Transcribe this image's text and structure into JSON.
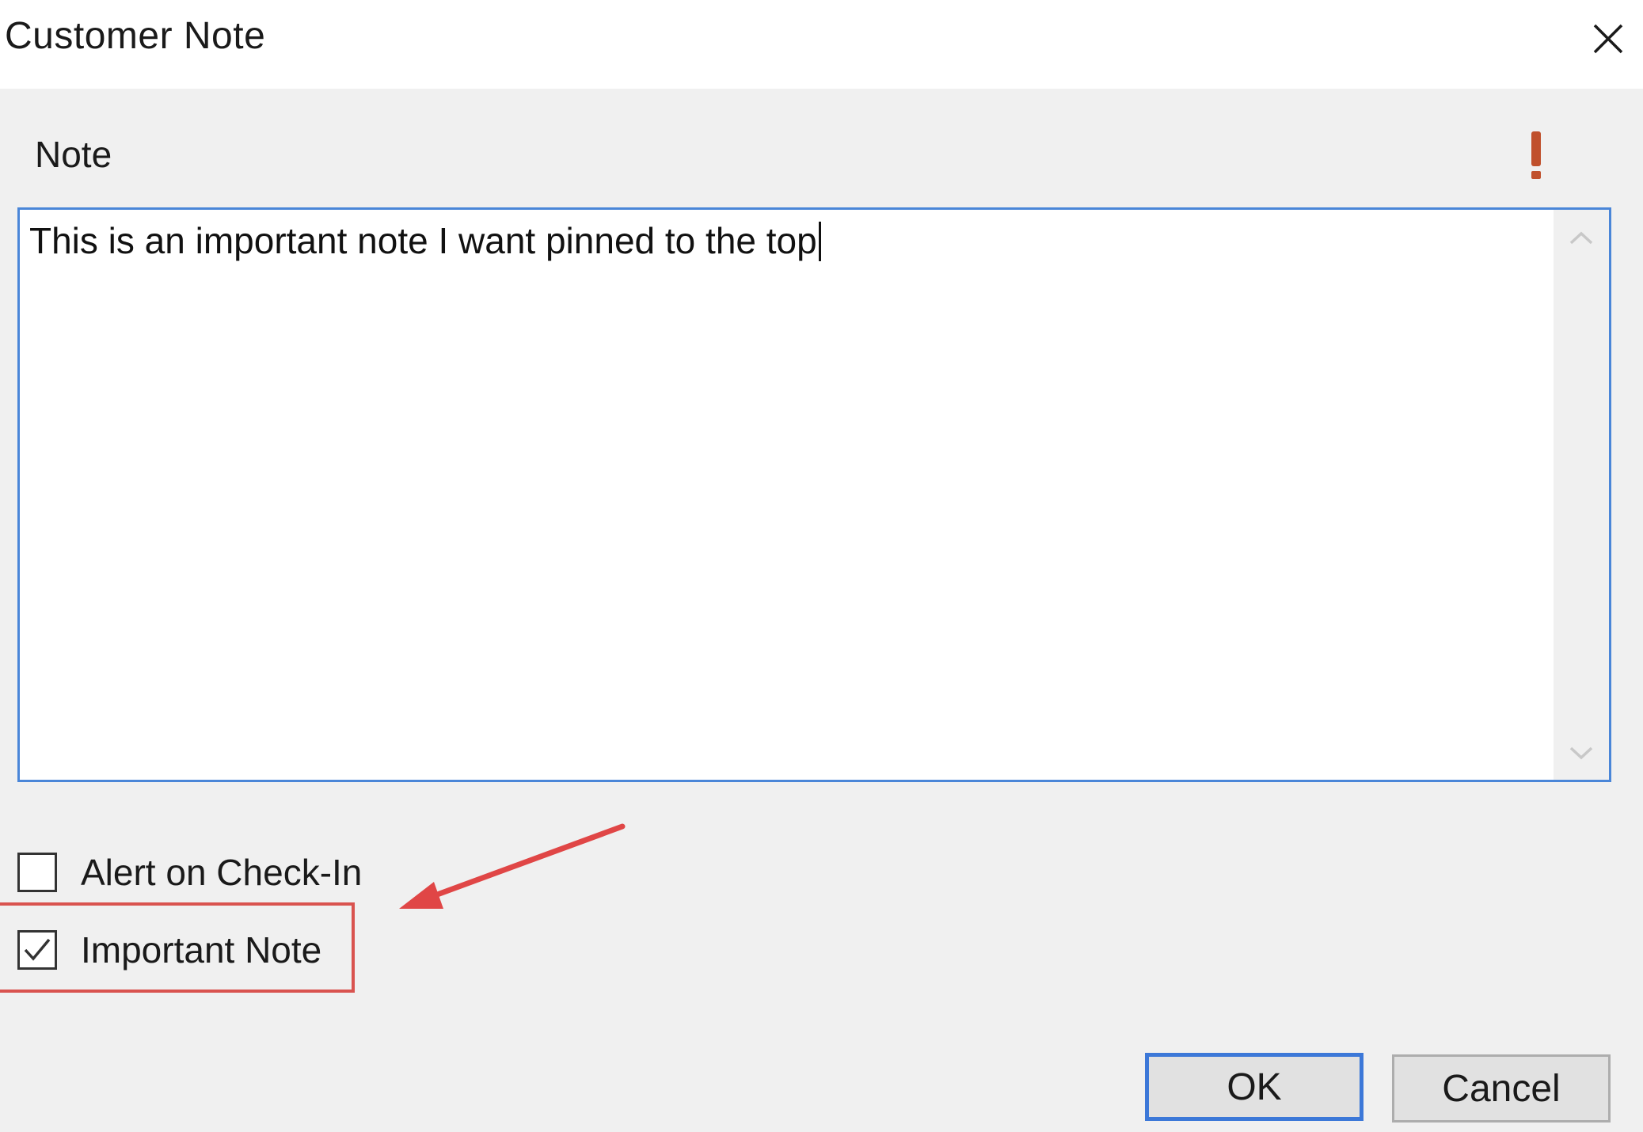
{
  "dialog": {
    "title": "Customer Note"
  },
  "note": {
    "label": "Note",
    "value": "This is an important note I want pinned to the top"
  },
  "options": {
    "alert_on_checkin": {
      "label": "Alert on Check-In",
      "checked": false
    },
    "important_note": {
      "label": "Important Note",
      "checked": true
    }
  },
  "buttons": {
    "ok_label": "OK",
    "cancel_label": "Cancel"
  },
  "colors": {
    "focus_border": "#4a86d8",
    "priority_icon": "#c0502c",
    "annotation": "#e04646"
  }
}
